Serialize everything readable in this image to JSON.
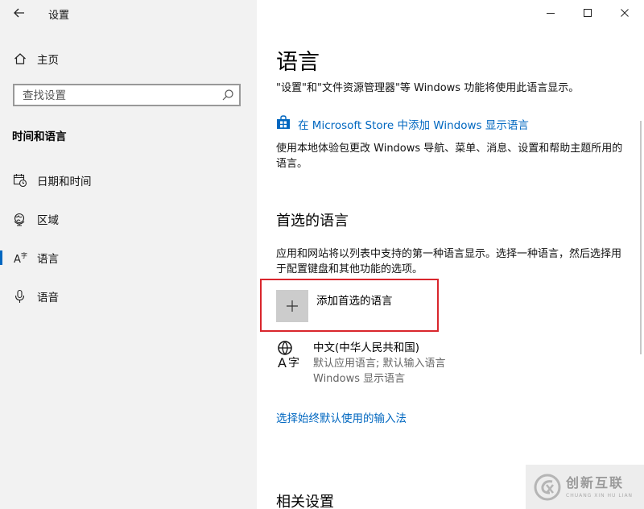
{
  "window": {
    "title": "设置",
    "controls": {
      "minimize": "minimize-icon",
      "maximize": "maximize-icon",
      "close": "close-icon"
    }
  },
  "sidebar": {
    "home_label": "主页",
    "search_placeholder": "查找设置",
    "group_title": "时间和语言",
    "items": [
      {
        "label": "日期和时间",
        "icon": "calendar-clock-icon"
      },
      {
        "label": "区域",
        "icon": "globe-icon"
      },
      {
        "label": "语言",
        "icon": "language-icon",
        "selected": true
      },
      {
        "label": "语音",
        "icon": "microphone-icon"
      }
    ]
  },
  "main": {
    "title": "语言",
    "description": "\"设置\"和\"文件资源管理器\"等 Windows 功能将使用此语言显示。",
    "store_link": "在 Microsoft Store 中添加 Windows 显示语言",
    "local_experience_text": "使用本地体验包更改 Windows 导航、菜单、消息、设置和帮助主题所用的语言。",
    "preferred_section_title": "首选的语言",
    "preferred_description": "应用和网站将以列表中支持的第一种语言显示。选择一种语言，然后选择用于配置键盘和其他功能的选项。",
    "add_language_label": "添加首选的语言",
    "languages": [
      {
        "name": "中文(中华人民共和国)",
        "detail1": "默认应用语言; 默认输入语言",
        "detail2": "Windows 显示语言",
        "icon": "language-glyph-icon"
      }
    ],
    "ime_link": "选择始终默认使用的输入法",
    "related_title": "相关设置"
  },
  "watermark": {
    "text": "创新互联",
    "subtext": "CHUANG XIN HU LIAN"
  },
  "colors": {
    "accent": "#0067c0",
    "highlight_box": "#d9262d",
    "sidebar_bg": "#f2f2f2"
  }
}
